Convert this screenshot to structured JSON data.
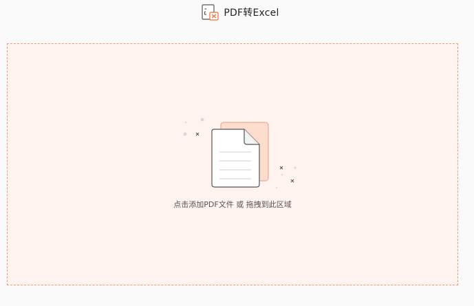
{
  "window": {
    "title": "PDF转Excel",
    "app_icon": "pdf-to-excel-icon"
  },
  "drop_zone": {
    "hint": "点击添加PDF文件 或 拖拽到此区域",
    "icon": "document-upload-icon",
    "border_color": "#ee9b76",
    "background_color": "#fff3ef"
  }
}
